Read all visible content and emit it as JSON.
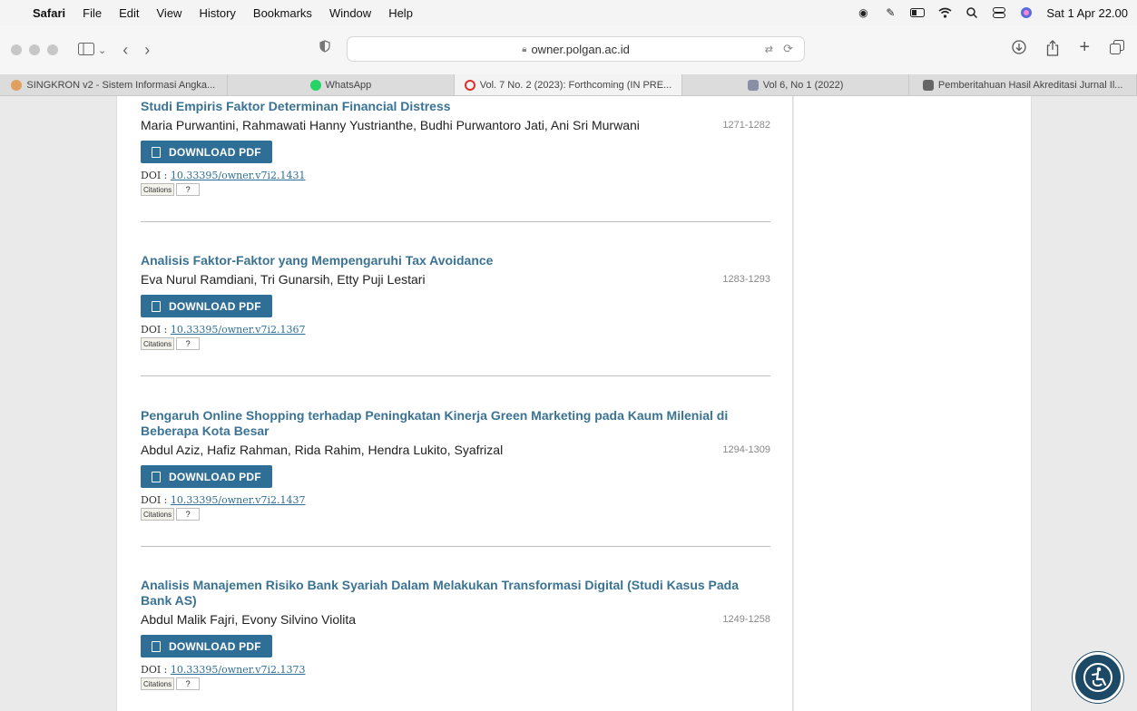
{
  "menubar": {
    "app": "Safari",
    "items": [
      "File",
      "Edit",
      "View",
      "History",
      "Bookmarks",
      "Window",
      "Help"
    ],
    "datetime": "Sat 1 Apr 22.00"
  },
  "toolbar": {
    "url": "owner.polgan.ac.id"
  },
  "tabs": [
    {
      "label": "SINGKRON v2 - Sistem Informasi Angka...",
      "color": "#e0a060"
    },
    {
      "label": "WhatsApp",
      "color": "#25d366"
    },
    {
      "label": "Vol. 7 No. 2 (2023): Forthcoming (IN PRE...",
      "color": "#e0302a"
    },
    {
      "label": "Vol 6, No 1 (2022)",
      "color": "#8a8fa6"
    },
    {
      "label": "Pemberitahuan Hasil Akreditasi Jurnal Il...",
      "color": "#666666"
    }
  ],
  "download_label": "DOWNLOAD PDF",
  "doi_label": "DOI :",
  "citations_label": "Citations",
  "citations_count": "?",
  "articles": [
    {
      "title": "Studi Empiris Faktor Determinan Financial Distress",
      "authors": "Maria Purwantini, Rahmawati Hanny Yustrianthe, Budhi Purwantoro Jati, Ani Sri Murwani",
      "pages": "1271-1282",
      "doi": "10.33395/owner.v7i2.1431"
    },
    {
      "title": "Analisis Faktor-Faktor yang Mempengaruhi Tax Avoidance",
      "authors": "Eva Nurul Ramdiani, Tri Gunarsih, Etty Puji Lestari",
      "pages": "1283-1293",
      "doi": "10.33395/owner.v7i2.1367"
    },
    {
      "title": "Pengaruh Online Shopping terhadap Peningkatan Kinerja Green Marketing pada Kaum Milenial di Beberapa Kota Besar",
      "authors": "Abdul Aziz, Hafiz Rahman, Rida Rahim, Hendra Lukito, Syafrizal",
      "pages": "1294-1309",
      "doi": "10.33395/owner.v7i2.1437"
    },
    {
      "title": "Analisis Manajemen Risiko Bank Syariah Dalam Melakukan Transformasi Digital (Studi Kasus Pada Bank AS)",
      "authors": "Abdul Malik Fajri, Evony Silvino Violita",
      "pages": "1249-1258",
      "doi": "10.33395/owner.v7i2.1373"
    }
  ]
}
